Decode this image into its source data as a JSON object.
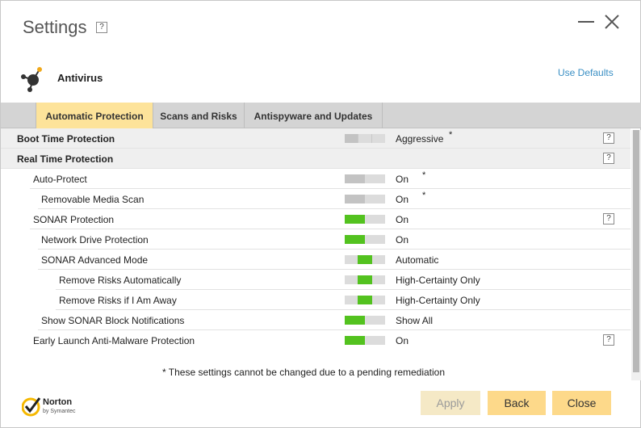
{
  "window": {
    "title": "Settings",
    "help": "?"
  },
  "section": {
    "name": "Antivirus",
    "use_defaults": "Use Defaults"
  },
  "tabs": [
    {
      "label": "Automatic Protection",
      "active": true
    },
    {
      "label": "Scans and Risks",
      "active": false
    },
    {
      "label": "Antispyware and Updates",
      "active": false
    }
  ],
  "rows": [
    {
      "label": "Boot Time Protection",
      "value": "Aggressive",
      "star": "*",
      "help": "?"
    },
    {
      "label": "Real Time Protection",
      "help": "?"
    },
    {
      "label": "Auto-Protect",
      "value": "On",
      "star": "*"
    },
    {
      "label": "Removable Media Scan",
      "value": "On",
      "star": "*"
    },
    {
      "label": "SONAR Protection",
      "value": "On",
      "help": "?"
    },
    {
      "label": "Network Drive Protection",
      "value": "On"
    },
    {
      "label": "SONAR Advanced Mode",
      "value": "Automatic"
    },
    {
      "label": "Remove Risks Automatically",
      "value": "High-Certainty Only"
    },
    {
      "label": "Remove Risks if I Am Away",
      "value": "High-Certainty Only"
    },
    {
      "label": "Show SONAR Block Notifications",
      "value": "Show All"
    },
    {
      "label": "Early Launch Anti-Malware Protection",
      "value": "On",
      "help": "?"
    }
  ],
  "footnote": "* These settings cannot be changed due to a pending remediation",
  "brand": {
    "name": "Norton",
    "sub": "by Symantec"
  },
  "buttons": {
    "apply": "Apply",
    "back": "Back",
    "close": "Close"
  },
  "colors": {
    "accent": "#fdd98a",
    "active_tab": "#fde39a",
    "toggle_on": "#53c21f",
    "link": "#3a8fc4"
  }
}
